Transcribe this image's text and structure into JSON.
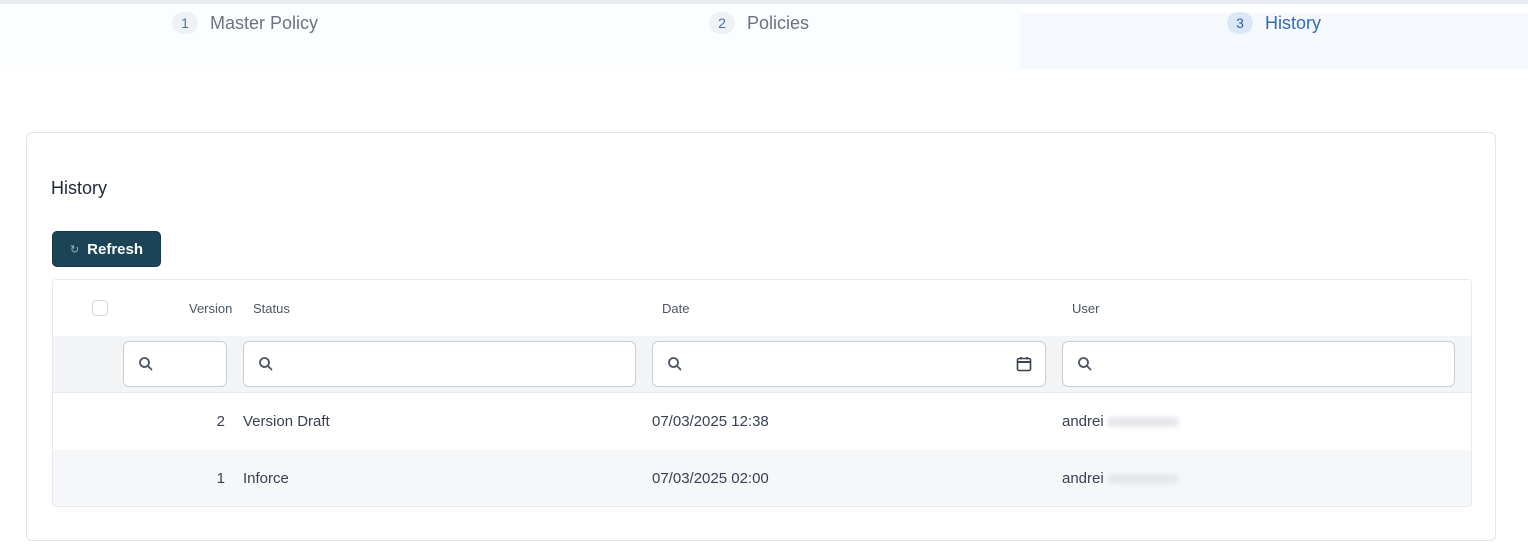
{
  "steps": [
    {
      "number": "1",
      "label": "Master Policy",
      "active": false
    },
    {
      "number": "2",
      "label": "Policies",
      "active": false
    },
    {
      "number": "3",
      "label": "History",
      "active": true
    }
  ],
  "history": {
    "title": "History",
    "refresh_label": "Refresh",
    "refresh_icon": "refresh-icon",
    "columns": {
      "version": "Version",
      "status": "Status",
      "date": "Date",
      "user": "User"
    },
    "filters": {
      "version": {
        "value": "",
        "icon": "search-icon"
      },
      "status": {
        "value": "",
        "icon": "search-icon"
      },
      "date": {
        "value": "",
        "icon": "search-icon",
        "trailing_icon": "calendar-icon"
      },
      "user": {
        "value": "",
        "icon": "search-icon"
      }
    },
    "rows": [
      {
        "version": "2",
        "status": "Version Draft",
        "date": "07/03/2025 12:38",
        "user": "andrei"
      },
      {
        "version": "1",
        "status": "Inforce",
        "date": "07/03/2025 02:00",
        "user": "andrei"
      }
    ]
  },
  "colors": {
    "accent": "#2f6db5",
    "button_bg": "#1c4457",
    "row_alt": "#f6f7f9"
  }
}
